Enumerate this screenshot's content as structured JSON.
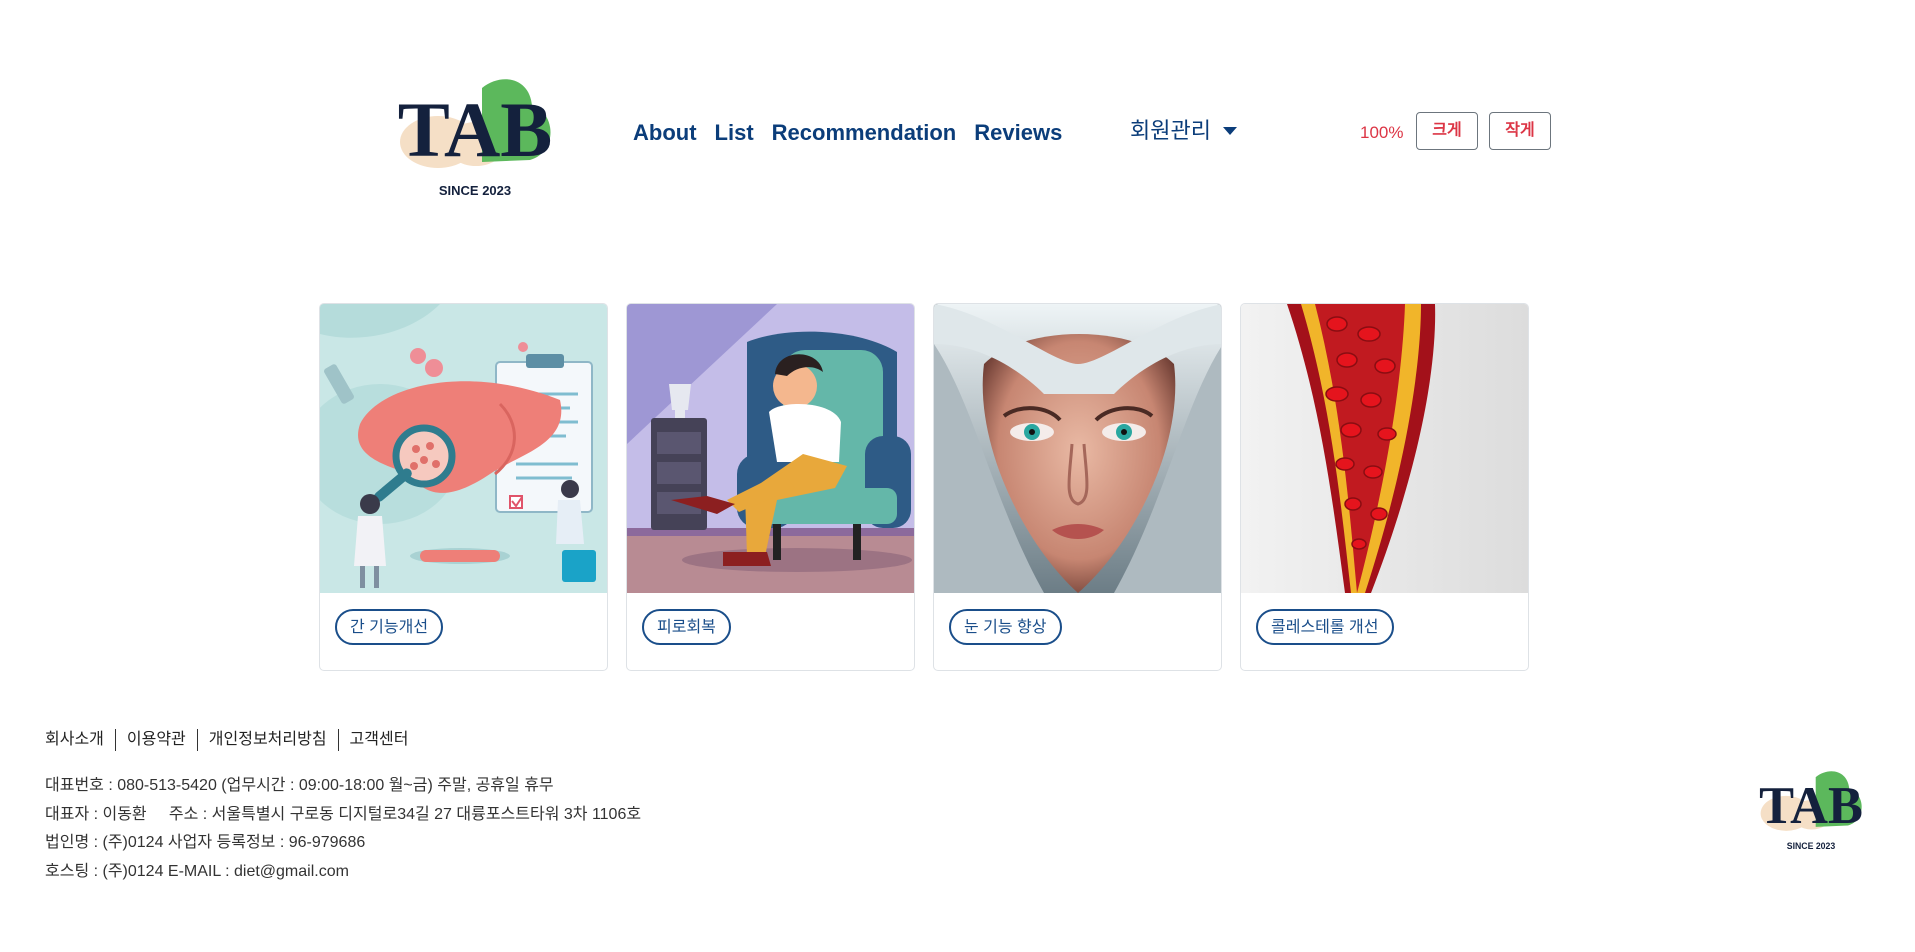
{
  "header": {
    "logo": {
      "text": "TAB",
      "since": "SINCE 2023"
    },
    "nav": [
      "About",
      "List",
      "Recommendation",
      "Reviews"
    ],
    "member_menu": "회원관리",
    "zoom": {
      "level": "100%",
      "bigger": "크게",
      "smaller": "작게"
    }
  },
  "cards": [
    {
      "label": "간 기능개선",
      "image": "liver-illustration"
    },
    {
      "label": "피로회복",
      "image": "tired-man-armchair-illustration"
    },
    {
      "label": "눈 기능 향상",
      "image": "woman-eyes-portrait"
    },
    {
      "label": "콜레스테롤 개선",
      "image": "blood-vessel-illustration"
    }
  ],
  "footer": {
    "links": [
      "회사소개",
      "이용약관",
      "개인정보처리방침",
      "고객센터"
    ],
    "info": [
      "대표번호 : 080-513-5420 (업무시간 : 09:00-18:00 월~금) 주말, 공휴일 휴무",
      "대표자 : 이동환     주소 : 서울특별시 구로동 디지털로34길 27 대륭포스트타워 3차 1106호",
      "법인명 : (주)0124 사업자 등록정보 : 96-979686",
      "호스팅 : (주)0124 E-MAIL : diet@gmail.com"
    ],
    "logo": {
      "text": "TAB",
      "since": "SINCE 2023"
    }
  },
  "colors": {
    "nav": "#0b3d7a",
    "accent_red": "#dc3545",
    "tag_border": "#1a4e8a",
    "logo_green": "#5cb85c",
    "logo_cream": "#f5dfc6"
  }
}
